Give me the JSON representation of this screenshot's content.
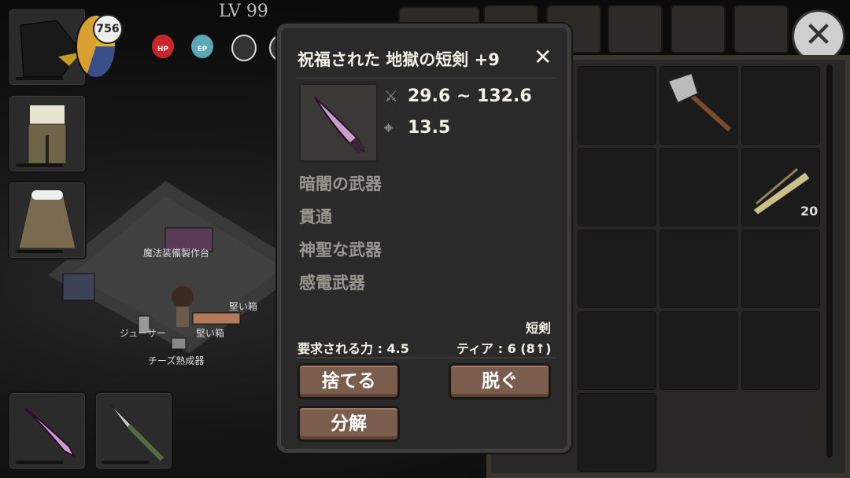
{
  "hud": {
    "level": "LV 99",
    "coin_count": "756",
    "orbs": [
      "HP",
      "EP",
      "",
      ""
    ]
  },
  "map": {
    "labels": [
      "魔法装備製作台",
      "堅い箱",
      "ジューサー",
      "堅い箱",
      "チーズ熟成器"
    ]
  },
  "inventory": {
    "axe_slot": "axe-icon",
    "bundle_count": "20"
  },
  "item_modal": {
    "title": "祝福された 地獄の短剣 +9",
    "damage": "29.6 ~ 132.6",
    "accuracy": "13.5",
    "traits": [
      "暗闇の武器",
      "貫通",
      "神聖な武器",
      "感電武器"
    ],
    "weapon_type": "短剣",
    "requirement": "要求される力 : 4.5",
    "tier": "ティア : 6 (8↑)",
    "buttons": {
      "discard": "捨てる",
      "unequip": "脱ぐ",
      "disassemble": "分解"
    }
  },
  "colors": {
    "hp": "#c8262a",
    "ep": "#5aa7b8",
    "button": "#7a5d4c",
    "modal_bg": "#2a2a2a"
  }
}
